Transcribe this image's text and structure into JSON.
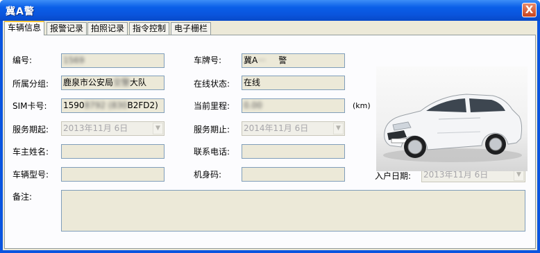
{
  "window": {
    "title": "冀A警"
  },
  "close_label": "X",
  "tabs": [
    {
      "label": "车辆信息"
    },
    {
      "label": "报警记录"
    },
    {
      "label": "拍照记录"
    },
    {
      "label": "指令控制"
    },
    {
      "label": "电子栅栏"
    }
  ],
  "form": {
    "number": {
      "label": "编号:",
      "value": "1569"
    },
    "plate": {
      "label": "车牌号:",
      "value_prefix": "冀A",
      "value_suffix": "警"
    },
    "group": {
      "label": "所属分组:",
      "value_prefix": "鹿泉市公安局",
      "value_hidden": "交警",
      "value_suffix": "大队"
    },
    "online": {
      "label": "在线状态:",
      "value": "在线"
    },
    "sim": {
      "label": "SIM卡号:",
      "value_prefix": "1590",
      "value_hidden": "8792 (830",
      "value_suffix": "B2FD2)"
    },
    "mileage": {
      "label": "当前里程:",
      "value": "0.00",
      "unit": "(km)"
    },
    "service_start": {
      "label": "服务期起:",
      "value": "2013年11月 6日"
    },
    "service_end": {
      "label": "服务期止:",
      "value": "2014年11月 6日"
    },
    "owner": {
      "label": "车主姓名:",
      "value": ""
    },
    "phone": {
      "label": "联系电话:",
      "value": ""
    },
    "model": {
      "label": "车辆型号:",
      "value": ""
    },
    "engine": {
      "label": "机身码:",
      "value": ""
    },
    "join_date": {
      "label": "入户日期:",
      "value": "2013年11月 6日"
    },
    "remarks": {
      "label": "备注:",
      "value": ""
    }
  },
  "icons": {
    "dropdown": "chevron-down-icon",
    "photo": "car-photo"
  },
  "colors": {
    "titlebar": "#0a55dd",
    "client": "#ece9d8",
    "field_bg": "#ece9d8",
    "field_border": "#7f9db9",
    "tab_highlight": "#ffc83c"
  }
}
